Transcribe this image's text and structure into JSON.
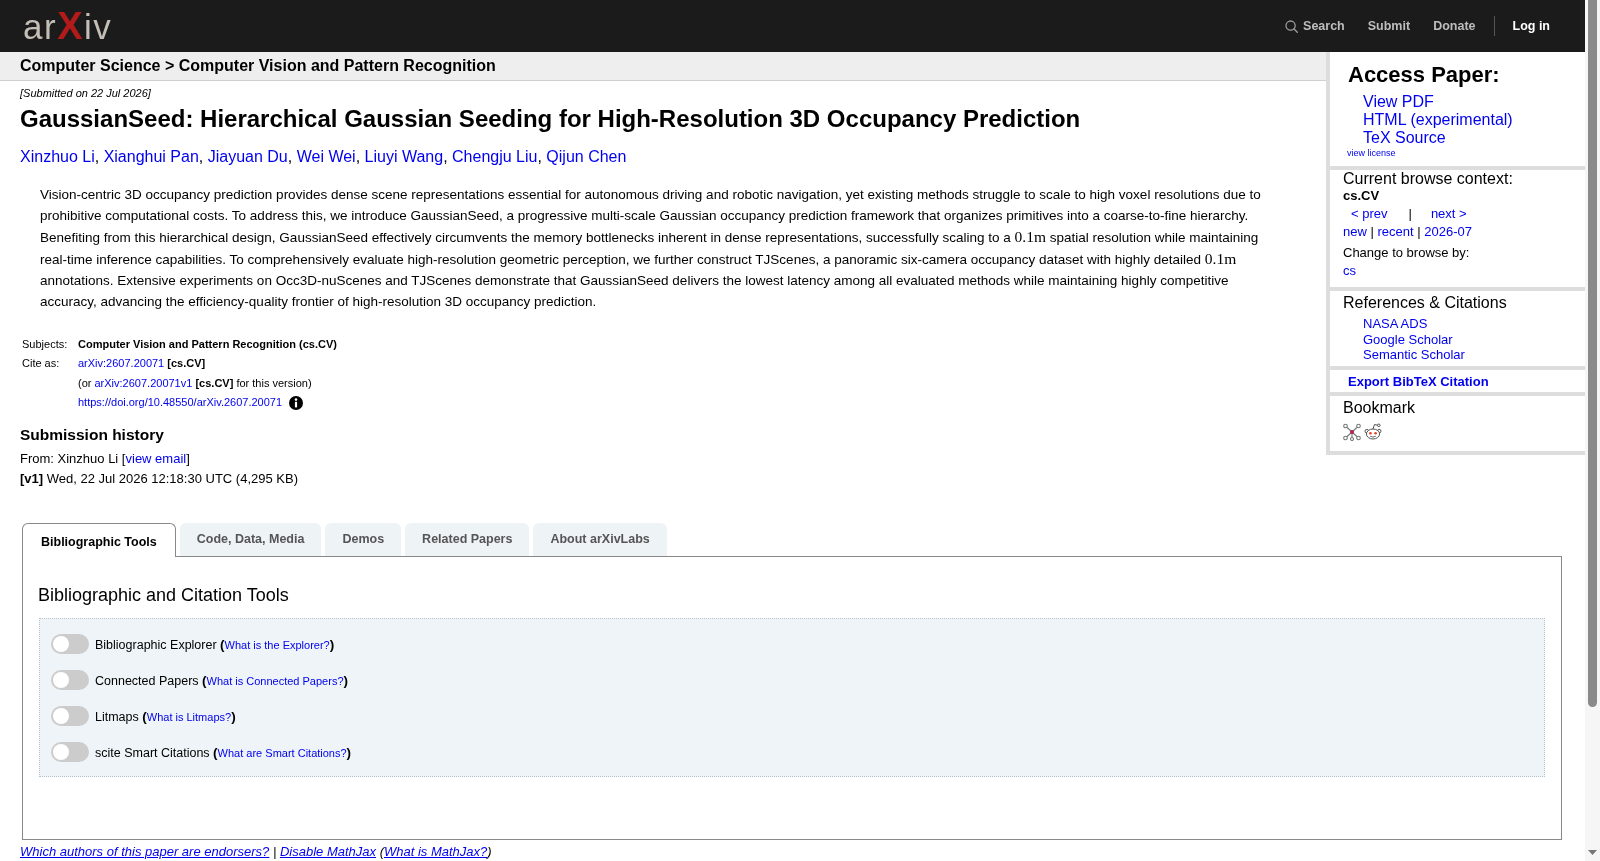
{
  "header": {
    "logo": "ar**X**iv",
    "nav": [
      {
        "kind": "search",
        "label": "Search"
      },
      {
        "kind": "link",
        "label": "Submit"
      },
      {
        "kind": "link",
        "label": "Donate"
      },
      {
        "kind": "login",
        "label": "Log in"
      }
    ]
  },
  "breadcrumb": "Computer Science > Computer Vision and Pattern Recognition",
  "paper": {
    "dateline": "[Submitted on 22 Jul 2026]",
    "title": "GaussianSeed: Hierarchical Gaussian Seeding for High-Resolution 3D Occupancy Prediction",
    "authors": [
      {
        "name": "Xinzhuo Li",
        "separator": ","
      },
      {
        "name": "Xianghui Pan",
        "separator": ","
      },
      {
        "name": "Jiayuan Du",
        "separator": ","
      },
      {
        "name": "Wei Wei",
        "separator": ","
      },
      {
        "name": "Liuyi Wang",
        "separator": ","
      },
      {
        "name": "Chengju Liu",
        "separator": ","
      },
      {
        "name": "Qijun Chen"
      }
    ],
    "abstract": [
      {
        "kind": "text",
        "text": "Vision-centric 3D occupancy prediction provides dense scene representations essential for autonomous driving and robotic navigation, yet existing methods struggle to scale to high voxel resolutions due to prohibitive computational costs. To address this, we introduce GaussianSeed, a progressive multi-scale Gaussian occupancy prediction framework that organizes primitives into a coarse-to-fine hierarchy. Benefiting from this hierarchical design, GaussianSeed effectively circumvents the memory bottlenecks inherent in dense representations, successfully scaling to a "
      },
      {
        "kind": "math",
        "text": "0.1m"
      },
      {
        "kind": "text",
        "text": " spatial resolution while maintaining real-time inference capabilities. To comprehensively evaluate high-resolution geometric perception, we further construct TJScenes, a panoramic six-camera occupancy dataset with highly detailed "
      },
      {
        "kind": "math",
        "text": "0.1m"
      },
      {
        "kind": "text",
        "text": " annotations. Extensive experiments on Occ3D-nuScenes and TJScenes demonstrate that GaussianSeed delivers the lowest latency among all evaluated methods while maintaining highly competitive accuracy, advancing the efficiency-quality frontier of high-resolution 3D occupancy prediction."
      }
    ],
    "metadata": [
      {
        "label": "Subjects:",
        "lines": [
          {
            "runs": [
              {
                "kind": "strong",
                "text": "Computer Vision and Pattern Recognition (cs.CV)"
              }
            ]
          }
        ]
      },
      {
        "label": "Cite as:",
        "lines": [
          {
            "runs": [
              {
                "kind": "link",
                "text": "arXiv:2607.20071"
              },
              {
                "kind": "text",
                "text": " **[cs.CV]**"
              }
            ]
          },
          {
            "runs": [
              {
                "kind": "text",
                "text": "(or "
              },
              {
                "kind": "link",
                "text": "arXiv:2607.20071v1"
              },
              {
                "kind": "text",
                "text": " **[cs.CV]** for this version)"
              }
            ]
          },
          {
            "runs": [
              {
                "kind": "link",
                "text": "https://doi.org/10.48550/arXiv.2607.20071"
              }
            ],
            "info_icon": true
          }
        ]
      }
    ],
    "history": {
      "heading": "Submission history",
      "from": [
        {
          "kind": "text",
          "text": "From: Xinzhuo Li ["
        },
        {
          "kind": "link",
          "text": "view email"
        },
        {
          "kind": "text",
          "text": "]"
        }
      ],
      "versions": [
        "**[v1]** Wed, 22 Jul 2026 12:18:30 UTC (4,295 KB)"
      ]
    }
  },
  "sidebar": {
    "access": {
      "heading": "Access Paper:",
      "links": [
        "View PDF",
        "HTML (experimental)",
        "TeX Source"
      ],
      "license": "view license"
    },
    "browse": {
      "heading": "Current browse context:",
      "context": "cs.CV",
      "prev": "< prev",
      "pager_separator": "|",
      "next": "next >",
      "periods": [
        {
          "label": "new",
          "separator": "|"
        },
        {
          "label": "recent",
          "separator": "|"
        },
        {
          "label": "2026-07"
        }
      ],
      "change_label": "Change to browse by:",
      "categories": [
        "cs"
      ]
    },
    "references": {
      "heading": "References & Citations",
      "links": [
        "NASA ADS",
        "Google Scholar",
        "Semantic Scholar"
      ]
    },
    "export": "Export BibTeX Citation",
    "bookmark": {
      "heading": "Bookmark"
    }
  },
  "labs": {
    "tabs": [
      {
        "label": "Bibliographic Tools",
        "selected": true
      },
      {
        "label": "Code, Data, Media",
        "selected": false
      },
      {
        "label": "Demos",
        "selected": false
      },
      {
        "label": "Related Papers",
        "selected": false
      },
      {
        "label": "About arXivLabs",
        "selected": false
      }
    ],
    "panel": {
      "heading": "Bibliographic and Citation Tools",
      "tools": [
        {
          "label": "Bibliographic Explorer",
          "open": "(",
          "help": "What is the Explorer?",
          "close": ")",
          "on": false
        },
        {
          "label": "Connected Papers",
          "open": "(",
          "help": "What is Connected Papers?",
          "close": ")",
          "on": false
        },
        {
          "label": "Litmaps",
          "open": "(",
          "help": "What is Litmaps?",
          "close": ")",
          "on": false
        },
        {
          "label": "scite Smart Citations",
          "open": "(",
          "help": "What are Smart Citations?",
          "close": ")",
          "on": false
        }
      ]
    }
  },
  "footer": [
    {
      "kind": "link",
      "text": "Which authors of this paper are endorsers?"
    },
    {
      "kind": "text",
      "text": " | "
    },
    {
      "kind": "link",
      "text": "Disable MathJax"
    },
    {
      "kind": "text",
      "text": " ("
    },
    {
      "kind": "link",
      "text": "What is MathJax?"
    },
    {
      "kind": "text",
      "text": ")"
    }
  ]
}
